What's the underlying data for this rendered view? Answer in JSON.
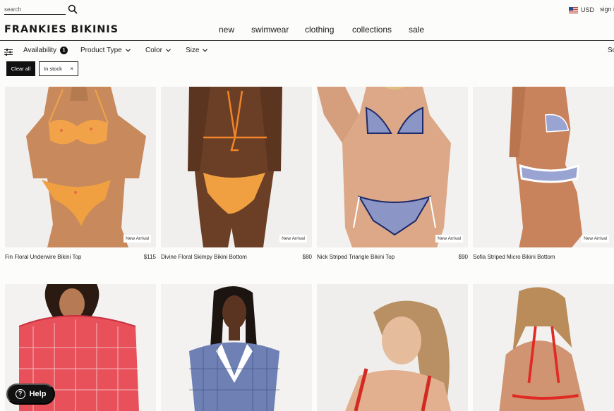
{
  "header": {
    "search_placeholder": "search",
    "currency": "USD",
    "signin": "sign in",
    "logo": "FRANKIES BIKINIS",
    "nav": [
      "new",
      "swimwear",
      "clothing",
      "collections",
      "sale"
    ]
  },
  "filters": {
    "availability": "Availability",
    "availability_count": "1",
    "product_type": "Product Type",
    "color": "Color",
    "size": "Size",
    "sort": "Sort",
    "clear_all": "Clear all",
    "active_chip": "In stock",
    "chip_remove": "×"
  },
  "products": [
    {
      "name": "Fin Floral Underwire Bikini Top",
      "price": "$115",
      "badge": "New Arrival"
    },
    {
      "name": "Divine Floral Skimpy Bikini Bottom",
      "price": "$80",
      "badge": "New Arrival"
    },
    {
      "name": "Nick Striped Triangle Bikini Top",
      "price": "$90",
      "badge": "New Arrival"
    },
    {
      "name": "Sofia Striped Micro Bikini Bottom",
      "price": "",
      "badge": "New Arrival"
    }
  ],
  "help": {
    "label": "Help",
    "icon_glyph": "?"
  },
  "icons": {
    "search": "search-icon",
    "flag": "us-flag-icon",
    "filter": "filter-sliders-icon",
    "chevron": "chevron-down-icon"
  },
  "colors": {
    "accent": "#111111",
    "background": "#fcfcfa"
  }
}
